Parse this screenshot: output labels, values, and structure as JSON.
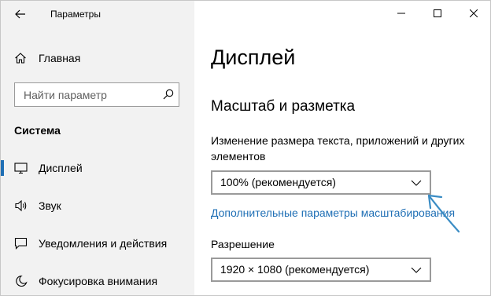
{
  "window": {
    "app_title": "Параметры"
  },
  "sidebar": {
    "home_label": "Главная",
    "search_placeholder": "Найти параметр",
    "section_heading": "Система",
    "items": [
      {
        "label": "Дисплей",
        "icon": "monitor-icon",
        "active": true
      },
      {
        "label": "Звук",
        "icon": "speaker-icon",
        "active": false
      },
      {
        "label": "Уведомления и действия",
        "icon": "notification-icon",
        "active": false
      },
      {
        "label": "Фокусировка внимания",
        "icon": "moon-icon",
        "active": false
      }
    ]
  },
  "main": {
    "page_title": "Дисплей",
    "section_title": "Масштаб и разметка",
    "scale_description": "Изменение размера текста, приложений и других элементов",
    "scale_value": "100% (рекомендуется)",
    "advanced_scaling_link": "Дополнительные параметры масштабирования",
    "resolution_label": "Разрешение",
    "resolution_value": "1920 × 1080 (рекомендуется)"
  },
  "colors": {
    "accent": "#1f6fb5",
    "sidebar_bg": "#f2f2f2",
    "annotation_arrow": "#3a8cc4"
  }
}
